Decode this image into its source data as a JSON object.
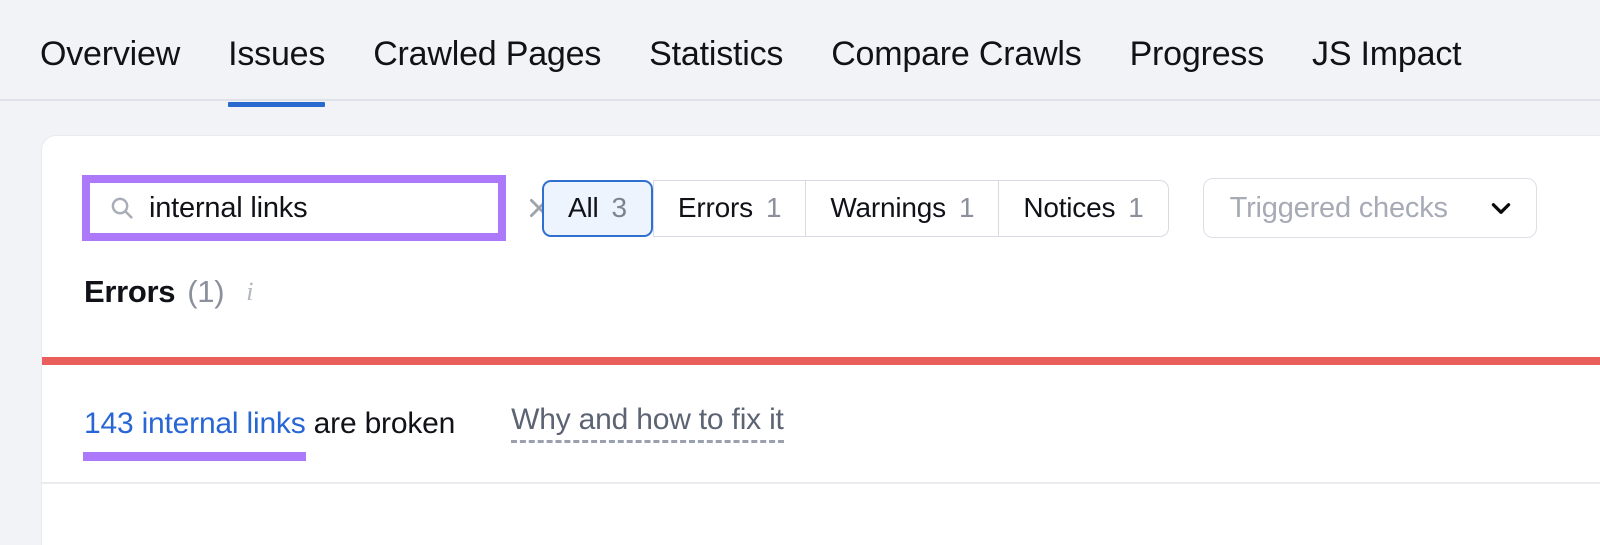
{
  "nav": {
    "tabs": [
      {
        "label": "Overview",
        "active": false
      },
      {
        "label": "Issues",
        "active": true
      },
      {
        "label": "Crawled Pages",
        "active": false
      },
      {
        "label": "Statistics",
        "active": false
      },
      {
        "label": "Compare Crawls",
        "active": false
      },
      {
        "label": "Progress",
        "active": false
      },
      {
        "label": "JS Impact",
        "active": false
      }
    ]
  },
  "toolbar": {
    "search": {
      "value": "internal links",
      "placeholder": "Search",
      "search_icon": "search-icon",
      "clear_icon": "close-icon",
      "highlight_color": "#ab79fa"
    },
    "filters": [
      {
        "label": "All",
        "count": "3",
        "selected": true
      },
      {
        "label": "Errors",
        "count": "1",
        "selected": false
      },
      {
        "label": "Warnings",
        "count": "1",
        "selected": false
      },
      {
        "label": "Notices",
        "count": "1",
        "selected": false
      }
    ],
    "dropdown": {
      "label": "Triggered checks",
      "chevron_icon": "chevron-down-icon"
    }
  },
  "section": {
    "title": "Errors",
    "count": "(1)",
    "info_icon": "info-icon",
    "severity_color": "#ea5f5c"
  },
  "issues": [
    {
      "link_text": "143 internal links",
      "rest_text": " are broken",
      "fix_label": "Why and how to fix it",
      "link_color": "#2766d4",
      "highlight_color": "#ab79fa"
    }
  ]
}
